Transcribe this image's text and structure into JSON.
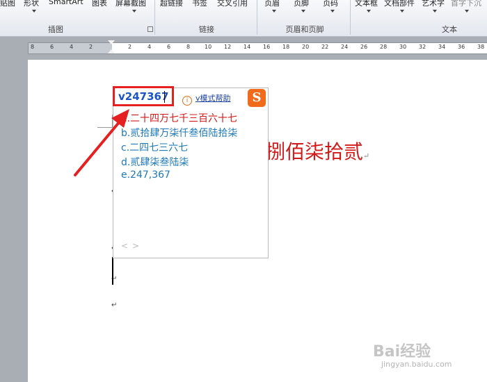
{
  "ribbon": {
    "buttons": [
      "贴图",
      "形状",
      "SmartArt",
      "图表",
      "屏幕截图",
      "超链接",
      "书签",
      "交叉引用",
      "页眉",
      "页脚",
      "页码",
      "文本框",
      "文档部件",
      "艺术字",
      "首字下沉"
    ],
    "groups": [
      "插图",
      "链接",
      "页眉和页脚",
      "文本"
    ]
  },
  "ruler": {
    "left_numbers": [
      "8",
      "6",
      "4",
      "2"
    ],
    "right_numbers": [
      "2",
      "4",
      "6",
      "8",
      "10",
      "12",
      "14",
      "16",
      "18",
      "20",
      "22",
      "24",
      "26",
      "28",
      "30",
      "32",
      "34",
      "36",
      "38"
    ]
  },
  "document": {
    "text_fragment": "捌佰柒拾贰",
    "para_mark": "↵"
  },
  "ime": {
    "input": "v247367",
    "help_icon_text": "i",
    "help": "v模式帮助",
    "logo": "S",
    "candidates": [
      "a.二十四万七千三百六十七",
      "b.贰拾肆万柒仟叁佰陆拾柒",
      "c.二四七三六七",
      "d.贰肆柒叁陆柒",
      "e.247,367"
    ],
    "nav": "<>"
  },
  "watermark": {
    "main": "Bai经验",
    "sub": "jingyan.baidu.com"
  },
  "colors": {
    "highlight_red": "#e52020",
    "candidate_blue": "#1e79b8",
    "first_candidate_red": "#d21919"
  }
}
